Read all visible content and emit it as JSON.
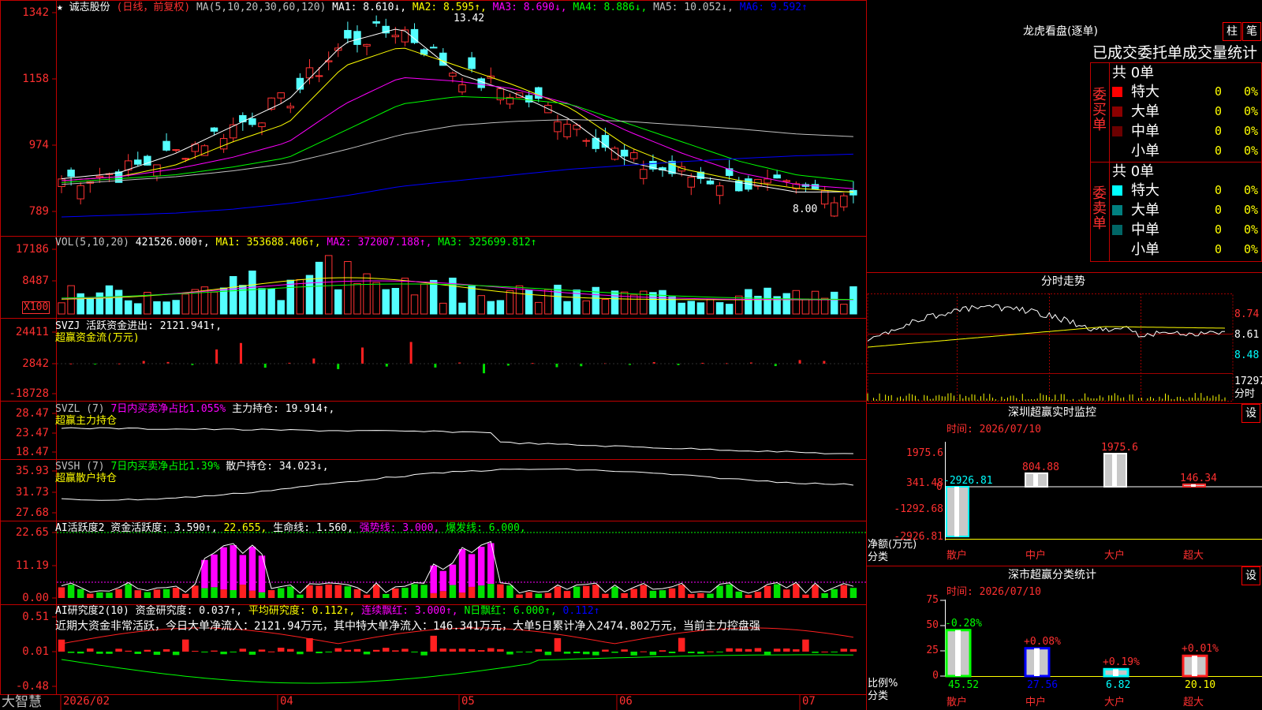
{
  "stock": {
    "star": "★",
    "name": "诚志股份",
    "period": "(日线，前复权)",
    "ma_legend": [
      {
        "text": "MA(5,10,20,30,60,120)",
        "color": "#c0c0c0"
      },
      {
        "text": "MA1: 8.610↓,",
        "color": "#ffffff"
      },
      {
        "text": "MA2: 8.595↑,",
        "color": "#ffff00"
      },
      {
        "text": "MA3: 8.690↓,",
        "color": "#ff00ff"
      },
      {
        "text": "MA4: 8.886↓,",
        "color": "#00ff00"
      },
      {
        "text": "MA5: 10.052↓,",
        "color": "#c0c0c0"
      },
      {
        "text": "MA6: 9.592↑",
        "color": "#0000ff"
      }
    ],
    "high_marker": "13.42",
    "low_marker": "8.00",
    "y_labels": [
      "1342",
      "1158",
      "974",
      "789"
    ]
  },
  "vol": {
    "legend": [
      {
        "text": "VOL(5,10,20)",
        "color": "#c0c0c0"
      },
      {
        "text": "421526.000↑,",
        "color": "#ffffff"
      },
      {
        "text": "MA1: 353688.406↑,",
        "color": "#ffff00"
      },
      {
        "text": "MA2: 372007.188↑,",
        "color": "#ff00ff"
      },
      {
        "text": "MA3: 325699.812↑",
        "color": "#00ff00"
      }
    ],
    "y_labels": [
      "17186",
      "8487"
    ],
    "unit": "X100"
  },
  "svzj": {
    "legend1": [
      {
        "text": "SVZJ  活跃资金进出: 2121.941↑,",
        "color": "#ffffff"
      }
    ],
    "legend2": "超赢资金流(万元)",
    "y_labels": [
      "24411",
      "2842",
      "-18728"
    ]
  },
  "svzl": {
    "legend1": [
      {
        "text": "SVZL (7)",
        "color": "#c0c0c0"
      },
      {
        "text": "7日内买卖净占比1.055%",
        "color": "#ff00ff"
      },
      {
        "text": "主力持仓: 19.914↑,",
        "color": "#ffffff"
      }
    ],
    "legend2": "超赢主力持仓",
    "y_labels": [
      "28.47",
      "23.47",
      "18.47"
    ]
  },
  "svsh": {
    "legend1": [
      {
        "text": "SVSH (7)",
        "color": "#c0c0c0"
      },
      {
        "text": "7日内买卖净占比1.39%",
        "color": "#00ff00"
      },
      {
        "text": "散户持仓: 34.023↓,",
        "color": "#ffffff"
      }
    ],
    "legend2": "超赢散户持仓",
    "y_labels": [
      "35.93",
      "31.73",
      "27.68"
    ]
  },
  "ai1": {
    "legend": [
      {
        "text": "AI活跃度2 资金活跃度: 3.590↑,",
        "color": "#ffffff"
      },
      {
        "text": "22.655,",
        "color": "#ffff00"
      },
      {
        "text": "生命线: 1.560,",
        "color": "#ffffff"
      },
      {
        "text": "强势线: 3.000,",
        "color": "#ff00ff"
      },
      {
        "text": "爆发线: 6.000,",
        "color": "#00ff00"
      }
    ],
    "y_labels": [
      "22.65",
      "11.19",
      "0.00"
    ]
  },
  "ai2": {
    "legend": [
      {
        "text": "AI研究度2(10) 资金研究度: 0.037↑,",
        "color": "#ffffff"
      },
      {
        "text": "平均研究度: 0.112↑,",
        "color": "#ffff00"
      },
      {
        "text": "连续飘红: 3.000↑,",
        "color": "#ff00ff"
      },
      {
        "text": "N日飘红: 6.000↑,",
        "color": "#00ff00"
      },
      {
        "text": "0.112↑",
        "color": "#0000ff"
      }
    ],
    "comment": "近期大资金非常活跃，今日大单净流入：2121.94万元，其中特大单净流入：146.341万元，大单5日累计净入2474.802万元，当前主力控盘强",
    "y_labels": [
      "0.51",
      "0.01",
      "-0.48"
    ]
  },
  "date_axis": {
    "brand": "大智慧",
    "labels": [
      "2026/02",
      "04",
      "05",
      "06",
      "07"
    ]
  },
  "right": {
    "lhb": {
      "title": "龙虎看盘(逐单)",
      "btn1": "柱",
      "btn2": "笔",
      "subtitle": "已成交委托单成交量统计",
      "buy": {
        "side_label": "委买单",
        "total": "共 0单",
        "rows": [
          {
            "label": "特大",
            "count": "0",
            "pct": "0%",
            "color": "#ff0000"
          },
          {
            "label": "大单",
            "count": "0",
            "pct": "0%",
            "color": "#8b0000"
          },
          {
            "label": "中单",
            "count": "0",
            "pct": "0%",
            "color": "#6b0000"
          },
          {
            "label": "小单",
            "count": "0",
            "pct": "0%",
            "color": ""
          }
        ]
      },
      "sell": {
        "side_label": "委卖单",
        "total": "共 0单",
        "rows": [
          {
            "label": "特大",
            "count": "0",
            "pct": "0%",
            "color": "#00ffff"
          },
          {
            "label": "大单",
            "count": "0",
            "pct": "0%",
            "color": "#008080"
          },
          {
            "label": "中单",
            "count": "0",
            "pct": "0%",
            "color": "#006666"
          },
          {
            "label": "小单",
            "count": "0",
            "pct": "0%",
            "color": ""
          }
        ]
      }
    },
    "intraday": {
      "title": "分时走势",
      "price_labels": [
        "8.74",
        "8.61",
        "8.48"
      ],
      "vol_label": "17297",
      "unit_label": "分时"
    },
    "monitor": {
      "title": "深圳超赢实时监控",
      "btn": "设",
      "time": "时间: 2026/07/10",
      "y_labels": [
        "1975.6",
        "341.48",
        "-1292.68",
        "-2926.81"
      ],
      "zero_label": "0",
      "y_title": "净额(万元)",
      "x_title": "分类",
      "categories": [
        "散户",
        "中户",
        "大户",
        "超大"
      ],
      "values": [
        -2926.81,
        804.88,
        1975.6,
        146.34
      ],
      "value_labels": [
        "-2926.81",
        "804.88",
        "1975.6",
        "146.34"
      ]
    },
    "classify": {
      "title": "深市超赢分类统计",
      "btn": "设",
      "time": "时间: 2026/07/10",
      "y_labels": [
        "75",
        "50",
        "25",
        "0"
      ],
      "y_title": "比例%",
      "x_title": "分类",
      "categories": [
        "散户",
        "中户",
        "大户",
        "超大"
      ],
      "values": [
        45.52,
        27.56,
        6.82,
        20.1
      ],
      "value_labels": [
        "45.52",
        "27.56",
        "6.82",
        "20.10"
      ],
      "change_labels": [
        "-0.28%",
        "+0.08%",
        "+0.19%",
        "+0.01%"
      ]
    }
  },
  "chart_data": [
    {
      "type": "line",
      "title": "诚志股份 (日线，前复权)",
      "ylim": [
        7.6,
        13.5
      ],
      "x": [
        "2026/02",
        "04",
        "05",
        "06",
        "07"
      ],
      "series": [
        {
          "name": "MA1",
          "values": [
            8.95,
            9.1,
            9.6,
            10.3,
            11.0,
            12.5,
            12.9,
            11.7,
            11.2,
            10.5,
            9.4,
            9.05,
            8.85,
            8.6,
            8.61
          ]
        },
        {
          "name": "MA2",
          "values": [
            8.9,
            9.0,
            9.3,
            9.9,
            10.4,
            11.9,
            12.4,
            11.9,
            11.4,
            10.8,
            9.8,
            9.2,
            8.9,
            8.7,
            8.595
          ]
        },
        {
          "name": "MA3",
          "values": [
            8.9,
            9.0,
            9.2,
            9.5,
            9.9,
            10.9,
            11.6,
            11.5,
            11.3,
            10.9,
            10.2,
            9.6,
            9.1,
            8.8,
            8.69
          ]
        },
        {
          "name": "MA4",
          "values": [
            8.85,
            8.95,
            9.05,
            9.25,
            9.5,
            10.2,
            10.9,
            11.1,
            11.05,
            10.9,
            10.4,
            9.9,
            9.4,
            9.05,
            8.886
          ]
        },
        {
          "name": "MA5",
          "values": [
            8.8,
            8.9,
            9.0,
            9.15,
            9.35,
            9.7,
            10.1,
            10.35,
            10.45,
            10.5,
            10.45,
            10.35,
            10.25,
            10.12,
            10.052
          ]
        },
        {
          "name": "MA6",
          "values": [
            7.95,
            8.0,
            8.05,
            8.15,
            8.3,
            8.5,
            8.75,
            8.9,
            9.05,
            9.2,
            9.3,
            9.4,
            9.48,
            9.55,
            9.592
          ]
        }
      ]
    },
    {
      "type": "bar",
      "title": "超赢资金流(万元)",
      "ylim": [
        -18728,
        24411
      ],
      "values": [
        120,
        -210,
        150,
        2100,
        1300,
        -900,
        11000,
        16000,
        -2500,
        700,
        4000,
        -3400,
        12500,
        -1800,
        16800,
        -2400,
        900,
        -6000,
        -1200,
        500,
        -2200,
        -1600,
        400,
        -800,
        1200,
        -900,
        650,
        400,
        900,
        -1500,
        2800,
        2121.941
      ]
    },
    {
      "type": "bar",
      "title": "深圳超赢实时监控",
      "categories": [
        "散户",
        "中户",
        "大户",
        "超大"
      ],
      "values": [
        -2926.81,
        804.88,
        1975.6,
        146.34
      ],
      "ylim": [
        -2926.81,
        1975.6
      ],
      "ylabel": "净额(万元)",
      "xlabel": "分类"
    },
    {
      "type": "bar",
      "title": "深市超赢分类统计",
      "categories": [
        "散户",
        "中户",
        "大户",
        "超大"
      ],
      "values": [
        45.52,
        27.56,
        6.82,
        20.1
      ],
      "ylim": [
        0,
        75
      ],
      "ylabel": "比例%",
      "xlabel": "分类"
    }
  ]
}
